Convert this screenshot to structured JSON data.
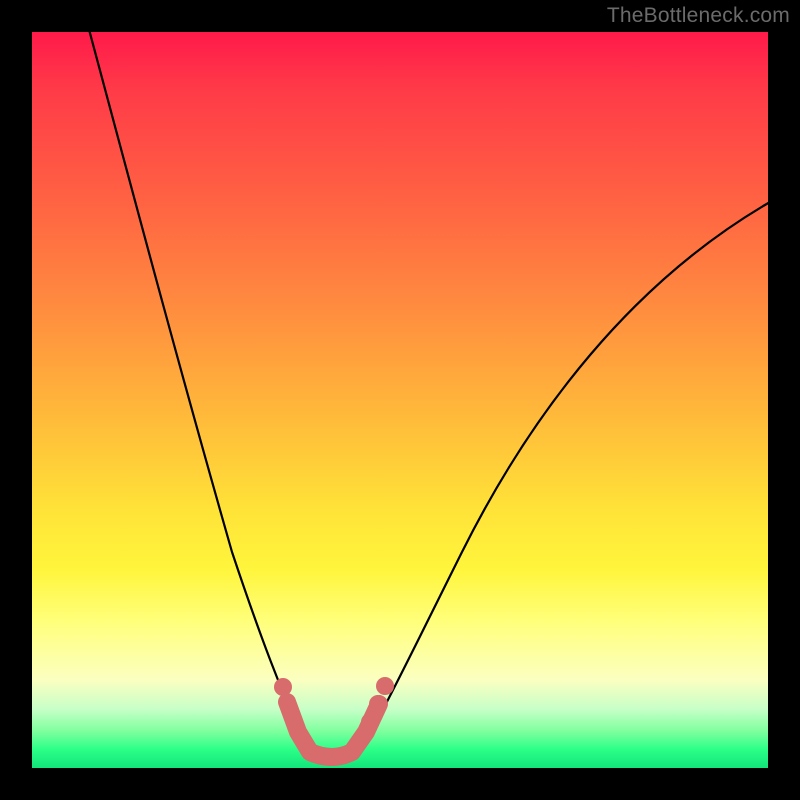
{
  "watermark": "TheBottleneck.com",
  "colors": {
    "frame": "#000000",
    "curve": "#000000",
    "marker": "#d86b6b",
    "gradient_top": "#ff1a4a",
    "gradient_bottom": "#12e57a"
  },
  "chart_data": {
    "type": "line",
    "title": "",
    "xlabel": "",
    "ylabel": "",
    "xlim": [
      0,
      100
    ],
    "ylim": [
      0,
      100
    ],
    "note": "Axes unlabeled; x expressed as 0–100 horizontal %, y as 0–100 where 100 = top (high bottleneck) and 0 = bottom (optimal/green).",
    "series": [
      {
        "name": "bottleneck-curve",
        "x": [
          8,
          12,
          16,
          20,
          24,
          28,
          30,
          32,
          34,
          36,
          38,
          39,
          40,
          41,
          42,
          44,
          46,
          50,
          55,
          60,
          66,
          74,
          82,
          90,
          100
        ],
        "values": [
          100,
          90,
          78,
          66,
          54,
          40,
          32,
          24,
          16,
          9,
          4,
          2,
          1,
          2,
          4,
          8,
          12,
          20,
          30,
          40,
          50,
          60,
          68,
          73,
          77
        ]
      }
    ],
    "optimal_marker": {
      "name": "optimal-region",
      "x_range": [
        34,
        47
      ],
      "y": 2,
      "description": "thick salmon highlight tracing the bottom of the valley"
    }
  }
}
